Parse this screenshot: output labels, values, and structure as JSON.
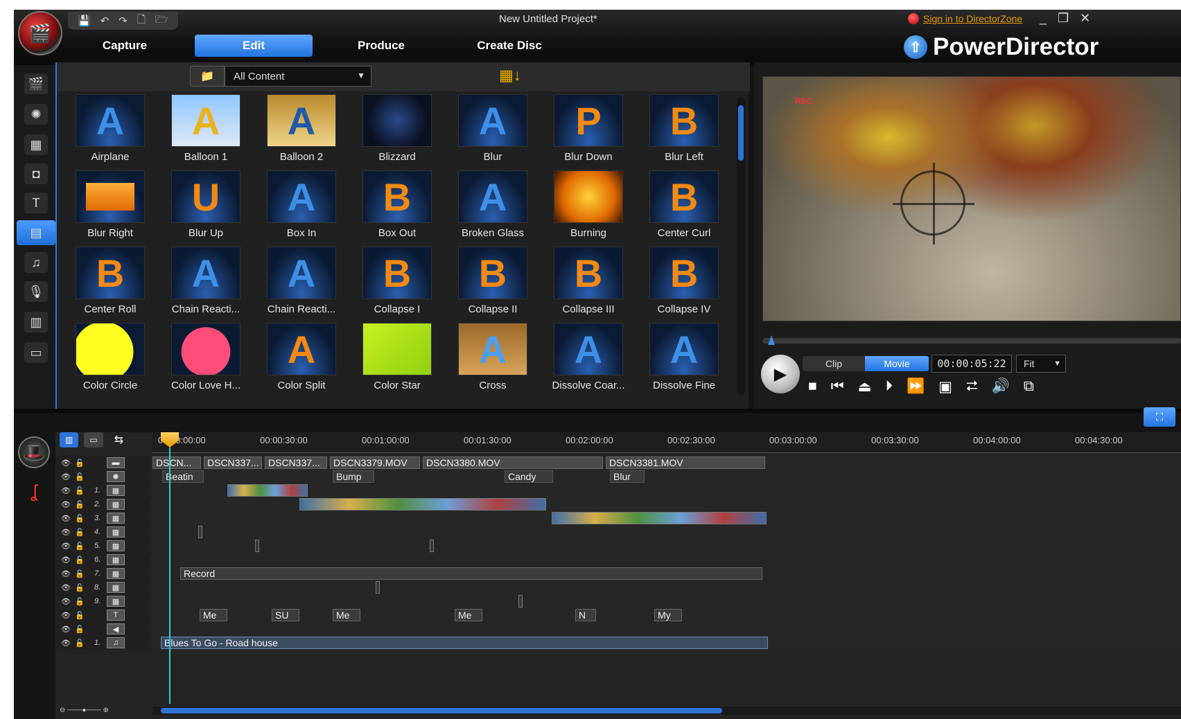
{
  "window": {
    "title": "New Untitled Project*",
    "sign_in": "Sign in to DirectorZone",
    "brand": "PowerDirector",
    "controls": [
      "_",
      "❐",
      "✕"
    ]
  },
  "quick_access": {
    "icons": [
      "save-icon",
      "undo-icon",
      "redo-icon",
      "new-project-icon",
      "open-project-icon"
    ],
    "glyphs": [
      "💾",
      "↶",
      "↷",
      "🗋",
      "🗁"
    ]
  },
  "tabs": [
    {
      "label": "Capture"
    },
    {
      "label": "Edit",
      "active": true
    },
    {
      "label": "Produce"
    },
    {
      "label": "Create Disc"
    }
  ],
  "rail": {
    "items": [
      "media-room",
      "effect-room",
      "pip-objects-room",
      "particle-room",
      "title-room",
      "transition-room",
      "audio-mixing-room",
      "voice-over-room",
      "chapter-room",
      "subtitle-room"
    ],
    "glyphs": [
      "🎬",
      "✺",
      "▦",
      "◘",
      "T",
      "▤",
      "♫",
      "🎙",
      "▥",
      "▭"
    ],
    "active": "transition-room"
  },
  "library": {
    "filter": "All Content",
    "sort_icon": "layout-sort-icon",
    "folder_icon": "folder-settings-icon",
    "items": [
      "Airplane",
      "Balloon 1",
      "Balloon 2",
      "Blizzard",
      "Blur",
      "Blur Down",
      "Blur Left",
      "Blur Right",
      "Blur Up",
      "Box In",
      "Box Out",
      "Broken Glass",
      "Burning",
      "Center Curl",
      "Center Roll",
      "Chain Reacti...",
      "Chain Reacti...",
      "Collapse I",
      "Collapse II",
      "Collapse III",
      "Collapse IV",
      "Color Circle",
      "Color Love H...",
      "Color Split",
      "Color Star",
      "Cross",
      "Dissolve Coar...",
      "Dissolve Fine"
    ],
    "glyphs": [
      "A",
      "A",
      "A",
      "",
      "A",
      "P",
      "B",
      "",
      "U",
      "A",
      "B",
      "A",
      "",
      "B",
      "B",
      "A",
      "A",
      "B",
      "B",
      "B",
      "B",
      "",
      "",
      "A",
      "",
      "A",
      "A",
      "A"
    ]
  },
  "preview": {
    "rec": "REC",
    "mode_clip": "Clip",
    "mode_movie": "Movie",
    "timecode": "00:00:05:22",
    "fit": "Fit",
    "controls": [
      "■",
      "⏮",
      "⏏",
      "⏵",
      "⏩",
      "▣",
      "⮂",
      "🔊",
      "⧉"
    ]
  },
  "timeline": {
    "ticks": [
      "00:00:00:00",
      "00:00:30:00",
      "00:01:00:00",
      "00:01:30:00",
      "00:02:00:00",
      "00:02:30:00",
      "00:03:00:00",
      "00:03:30:00",
      "00:04:00:00",
      "00:04:30:00"
    ],
    "tools": {
      "storyboard": "▥",
      "timeline": "⇆"
    },
    "video_clips": [
      "DSCN...",
      "DSCN337...",
      "DSCN337...",
      "DSCN3379.MOV",
      "DSCN3380.MOV",
      "DSCN3381.MOV"
    ],
    "transitions": [
      "Beatin",
      "Bump",
      "Candy",
      "Blur"
    ],
    "text_clip": "Record",
    "title_clips": [
      "Me",
      "SU",
      "Me",
      "Me",
      "N",
      "My"
    ],
    "audio_clip": "Blues To Go - Road house",
    "track_numbers": [
      "1.",
      "2.",
      "3.",
      "4.",
      "5.",
      "6.",
      "7.",
      "8.",
      "9.",
      "1."
    ]
  }
}
